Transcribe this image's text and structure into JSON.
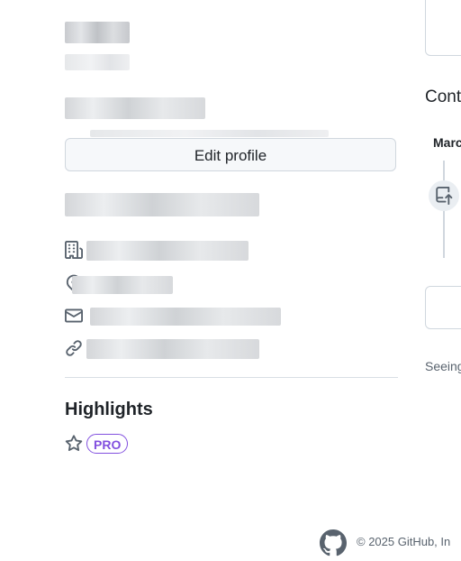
{
  "profile": {
    "edit_button_label": "Edit profile"
  },
  "highlights": {
    "title": "Highlights",
    "badge": "PRO"
  },
  "contributions": {
    "title": "Cont",
    "month": "Marc",
    "seeing_text": "Seeing"
  },
  "footer": {
    "text": "© 2025 GitHub, In"
  },
  "icons": {
    "organization": "organization-icon",
    "location": "location-icon",
    "email": "mail-icon",
    "link": "link-icon",
    "star": "star-icon",
    "repo_push": "repo-push-icon",
    "github": "github-mark-icon"
  },
  "colors": {
    "accent_purple": "#8250df",
    "border": "#d0d7de",
    "text": "#1f2328",
    "muted": "#59636e"
  }
}
